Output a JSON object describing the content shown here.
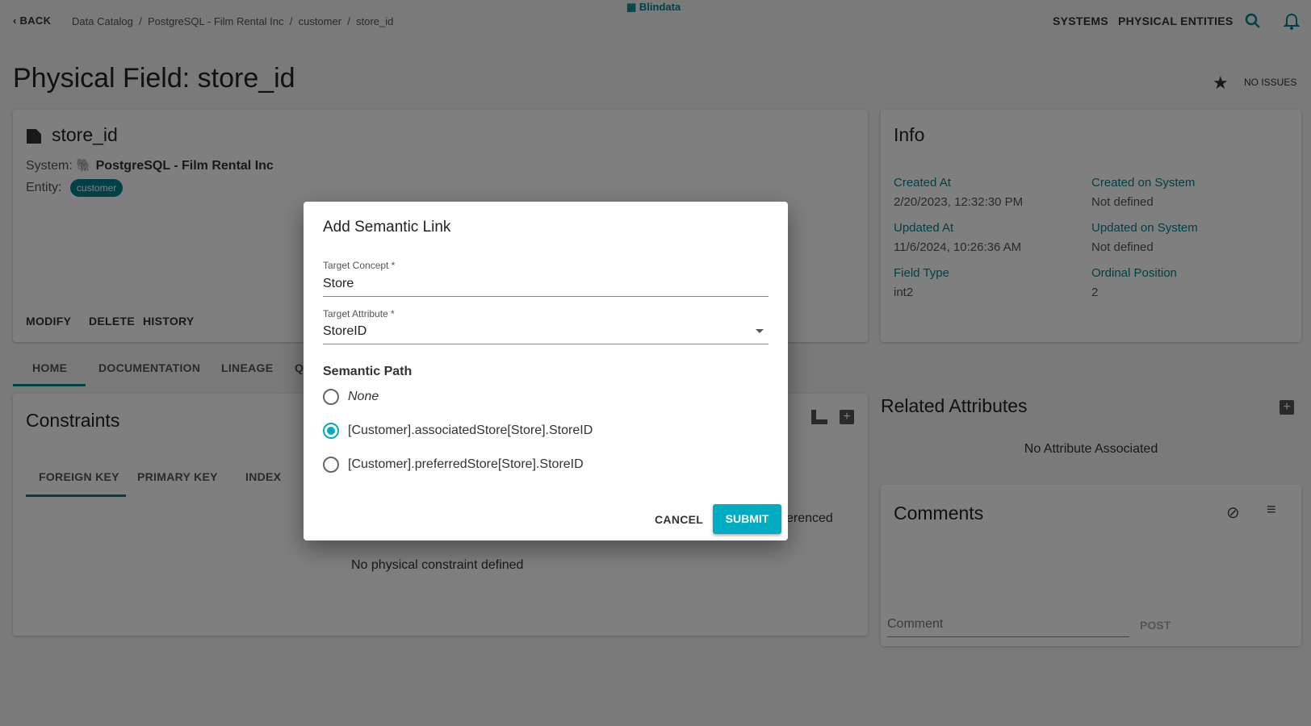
{
  "header": {
    "back": "BACK",
    "breadcrumb": [
      "Data Catalog",
      "PostgreSQL - Film Rental Inc",
      "customer",
      "store_id"
    ],
    "brand": "Blindata",
    "nav": [
      "SYSTEMS",
      "PHYSICAL ENTITIES"
    ]
  },
  "page": {
    "title": "Physical Field: store_id",
    "issues": "NO ISSUES"
  },
  "field_card": {
    "name": "store_id",
    "system_label": "System:",
    "system": "PostgreSQL - Film Rental Inc",
    "entity_label": "Entity:",
    "entity": "customer",
    "actions": [
      "MODIFY",
      "DELETE",
      "HISTORY"
    ]
  },
  "info": {
    "title": "Info",
    "items": [
      {
        "label": "Created At",
        "value": "2/20/2023, 12:32:30 PM"
      },
      {
        "label": "Created on System",
        "value": "Not defined"
      },
      {
        "label": "Updated At",
        "value": "11/6/2024, 10:26:36 AM"
      },
      {
        "label": "Updated on System",
        "value": "Not defined"
      },
      {
        "label": "Field Type",
        "value": "int2"
      },
      {
        "label": "Ordinal Position",
        "value": "2"
      }
    ]
  },
  "tabs": [
    "HOME",
    "DOCUMENTATION",
    "LINEAGE",
    "Q"
  ],
  "constraints": {
    "title": "Constraints",
    "tabs": [
      "FOREIGN KEY",
      "PRIMARY KEY",
      "INDEX"
    ],
    "partial": "erenced",
    "empty": "No physical constraint defined"
  },
  "related": {
    "title": "Related Attributes",
    "empty": "No Attribute Associated"
  },
  "comments": {
    "title": "Comments",
    "placeholder": "Comment",
    "post": "POST"
  },
  "dialog": {
    "title": "Add Semantic Link",
    "concept_label": "Target Concept *",
    "concept_value": "Store",
    "attribute_label": "Target Attribute *",
    "attribute_value": "StoreID",
    "path_label": "Semantic Path",
    "options": [
      "None",
      "[Customer].associatedStore[Store].StoreID",
      "[Customer].preferredStore[Store].StoreID"
    ],
    "selected_index": 1,
    "cancel": "CANCEL",
    "submit": "SUBMIT"
  },
  "colors": {
    "accent": "#00838f",
    "submit": "#00acc1"
  }
}
